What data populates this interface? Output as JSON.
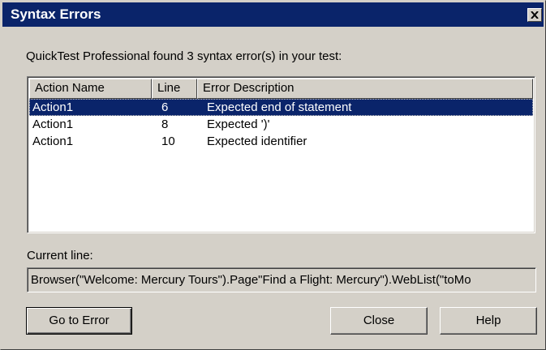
{
  "window": {
    "title": "Syntax Errors",
    "close_icon": "close-icon"
  },
  "summary": "QuickTest Professional found 3 syntax error(s) in your test:",
  "table": {
    "columns": [
      "Action Name",
      "Line",
      "Error Description"
    ],
    "rows": [
      {
        "action": "Action1",
        "line": "6",
        "description": "Expected end of statement",
        "selected": true
      },
      {
        "action": "Action1",
        "line": "8",
        "description": "Expected ')'",
        "selected": false
      },
      {
        "action": "Action1",
        "line": "10",
        "description": "Expected identifier",
        "selected": false
      }
    ]
  },
  "current_line": {
    "label": "Current line:",
    "value": "Browser(\"Welcome: Mercury Tours\").Page\"Find a Flight: Mercury\").WebList(\"toMo"
  },
  "buttons": {
    "go_to_error": "Go to Error",
    "close": "Close",
    "help": "Help"
  },
  "colors": {
    "titlebar": "#0a246a",
    "dialog_face": "#d4d0c8",
    "selection": "#0a246a"
  }
}
